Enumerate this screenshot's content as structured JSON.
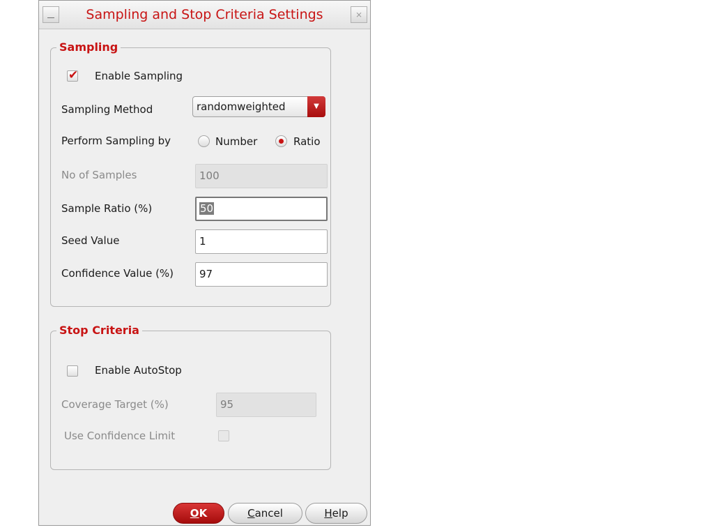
{
  "window": {
    "title": "Sampling and Stop Criteria Settings",
    "close_glyph": "⨯"
  },
  "sampling": {
    "group_title": "Sampling",
    "enable_label": "Enable Sampling",
    "enable_checked": true,
    "method_label": "Sampling Method",
    "method_value": "randomweighted",
    "perform_by_label": "Perform Sampling by",
    "radio_number_label": "Number",
    "radio_ratio_label": "Ratio",
    "selected_radio": "Ratio",
    "num_samples_label": "No of Samples",
    "num_samples_value": "100",
    "ratio_label": "Sample Ratio  (%)",
    "ratio_value": "50",
    "seed_label": "Seed Value",
    "seed_value": "1",
    "confidence_label": "Confidence Value (%)",
    "confidence_value": "97"
  },
  "stop": {
    "group_title": "Stop Criteria",
    "autostop_label": "Enable AutoStop",
    "autostop_checked": false,
    "coverage_label": "Coverage Target (%)",
    "coverage_value": "95",
    "use_conf_label": "Use Confidence Limit",
    "use_conf_checked": false
  },
  "buttons": {
    "ok": {
      "mnemonic": "O",
      "rest": "K"
    },
    "cancel": {
      "mnemonic": "C",
      "rest": "ancel"
    },
    "help": {
      "mnemonic": "H",
      "rest": "elp"
    }
  },
  "colors": {
    "accent": "#c81414",
    "window_bg": "#efefef"
  },
  "icons": {
    "minimize": "minimize-icon",
    "close": "close-icon",
    "check": "checkmark-icon",
    "dropdown": "chevron-down-icon"
  }
}
